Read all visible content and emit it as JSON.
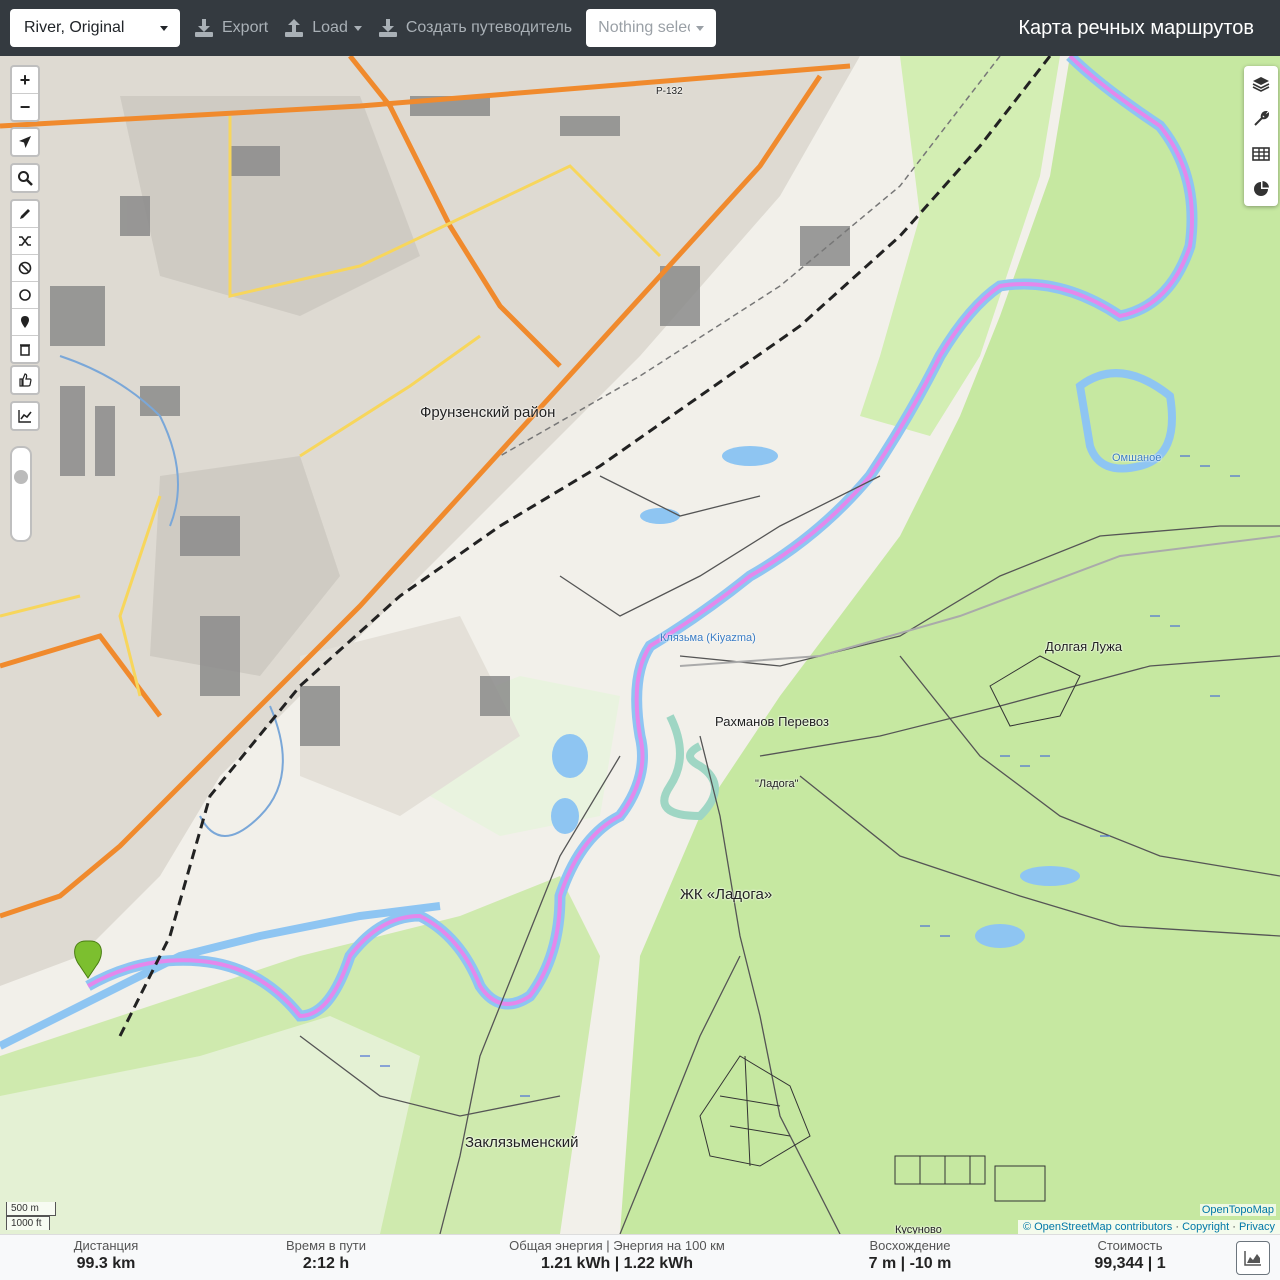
{
  "toolbar": {
    "profile": "River, Original",
    "export_label": "Export",
    "load_label": "Load",
    "guide_label": "Создать путеводитель",
    "nothing_selected": "Nothing selected",
    "app_title": "Карта речных маршрутов"
  },
  "map": {
    "zoom_in": "+",
    "zoom_out": "−",
    "labels": {
      "frunzensky": "Фрунзенский район",
      "klyazma_1": "Клязьма (Kiyazma)",
      "rakhmanov": "Рахманов Перевоз",
      "ladoga": "\"Ладога\"",
      "zhk_ladoga": "ЖК «Ладога»",
      "dolgaya_luzha": "Долгая Лужа",
      "zaklyazmensky": "Заклязьменский",
      "omshanoe": "Омшаное",
      "kusunovo": "Кусуново",
      "r132": "Р-132"
    },
    "scale": {
      "metric": "500 m",
      "imperial": "1000 ft"
    },
    "attribution": {
      "opentopomap": "OpenTopoMap",
      "osm": "© OpenStreetMap contributors",
      "copyright": "Copyright",
      "privacy": "Privacy"
    }
  },
  "stats": {
    "distance": {
      "label": "Дистанция",
      "value": "99.3 km"
    },
    "time": {
      "label": "Время в пути",
      "value": "2:12 h"
    },
    "energy": {
      "label": "Общая энергия | Энергия на 100 км",
      "value": "1.21 kWh | 1.22 kWh"
    },
    "ascent": {
      "label": "Восхождение",
      "value": "7 m | -10 m"
    },
    "cost": {
      "label": "Стоимость",
      "value": "99,344 | 1"
    }
  },
  "colors": {
    "topbar": "#343a40",
    "forest": "#c6e8a1",
    "river": "#8ec5f2",
    "route": "#e488ec",
    "arterial": "#f08a2d"
  }
}
